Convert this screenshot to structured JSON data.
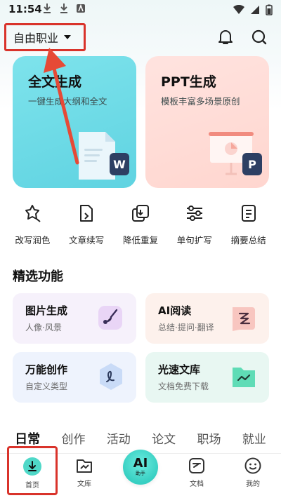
{
  "status_bar": {
    "time": "11:54",
    "left_icons": [
      "download-icon",
      "download-icon",
      "app-notification-icon"
    ],
    "right_icons": [
      "wifi-icon",
      "signal-icon",
      "battery-icon"
    ]
  },
  "header": {
    "job_selector": "自由职业",
    "actions": [
      "bell-icon",
      "search-icon"
    ]
  },
  "hero_cards": [
    {
      "title": "全文生成",
      "subtitle": "一键生成大纲和全文",
      "badge": "W",
      "color": "#5fd3e1"
    },
    {
      "title": "PPT生成",
      "subtitle": "模板丰富多场景原创",
      "badge": "P",
      "color": "#ffd6cf"
    }
  ],
  "tools": [
    {
      "label": "改写润色",
      "icon": "rewrite-icon"
    },
    {
      "label": "文章续写",
      "icon": "continue-icon"
    },
    {
      "label": "降低重复",
      "icon": "dedupe-icon"
    },
    {
      "label": "单句扩写",
      "icon": "expand-icon"
    },
    {
      "label": "摘要总结",
      "icon": "summary-icon"
    }
  ],
  "featured": {
    "title": "精选功能",
    "items": [
      {
        "title": "图片生成",
        "subtitle": "人像·风景",
        "icon": "image-gen-icon",
        "color": "#f3e9fb"
      },
      {
        "title": "AI阅读",
        "subtitle": "总结·提问·翻译",
        "icon": "ai-read-icon",
        "color": "#fdeee8"
      },
      {
        "title": "万能创作",
        "subtitle": "自定义类型",
        "icon": "create-icon",
        "color": "#eaf1fd"
      },
      {
        "title": "光速文库",
        "subtitle": "文档免费下载",
        "icon": "library-icon",
        "color": "#e6f7f2"
      }
    ]
  },
  "category_tabs": [
    "日常",
    "创作",
    "活动",
    "论文",
    "职场",
    "就业"
  ],
  "active_tab": "日常",
  "bottom_nav": [
    {
      "label": "首页",
      "icon": "home-download-icon"
    },
    {
      "label": "文库",
      "icon": "library-nav-icon"
    },
    {
      "label": "助手",
      "ai_text": "AI",
      "icon": "ai-assistant-icon"
    },
    {
      "label": "文档",
      "icon": "document-nav-icon"
    },
    {
      "label": "我的",
      "icon": "profile-icon"
    }
  ]
}
